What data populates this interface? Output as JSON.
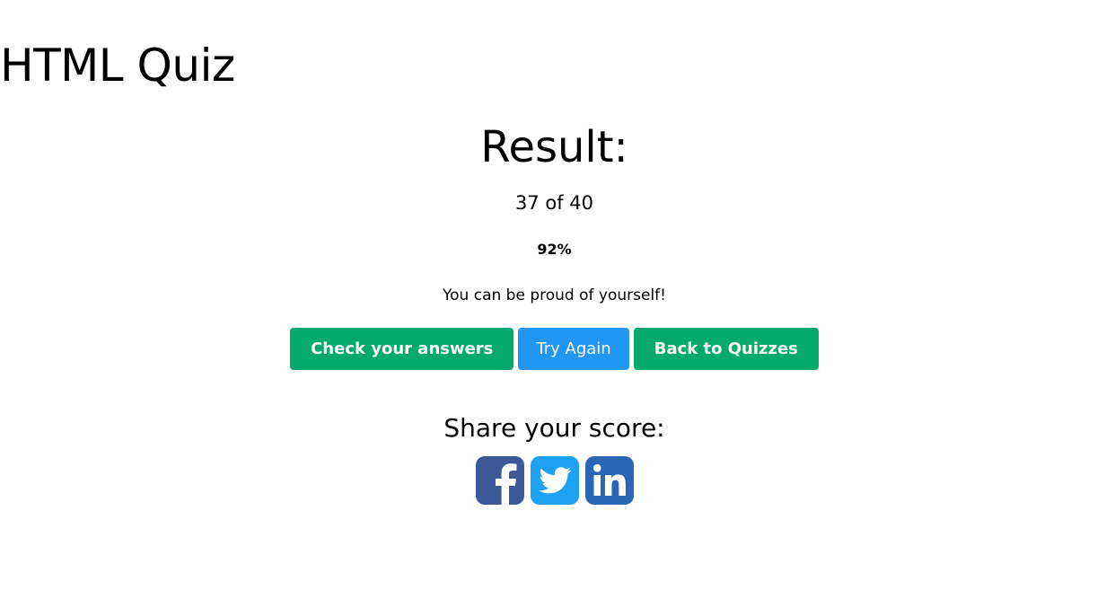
{
  "page": {
    "title": "HTML Quiz"
  },
  "result": {
    "heading": "Result:",
    "score_text": "37 of 40",
    "percent_text": "92%",
    "message": "You can be proud of yourself!"
  },
  "buttons": {
    "check_answers": "Check your answers",
    "try_again": "Try Again",
    "back_to_quizzes": "Back to Quizzes"
  },
  "share": {
    "heading": "Share your score:",
    "icons": [
      "facebook-icon",
      "twitter-icon",
      "linkedin-icon"
    ]
  },
  "colors": {
    "green_button": "#04aa6d",
    "blue_button": "#2196f3",
    "facebook": "#3b5998",
    "twitter": "#1da1f2",
    "linkedin": "#2a66b3"
  }
}
